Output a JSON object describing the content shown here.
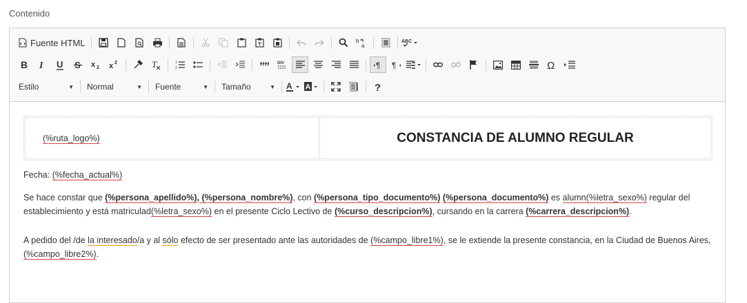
{
  "field_label": "Contenido",
  "toolbar": {
    "source_label": "Fuente HTML",
    "style_combo": "Estilo",
    "format_combo": "Normal",
    "font_combo": "Fuente",
    "size_combo": "Tamaño"
  },
  "doc": {
    "logo_placeholder": "(%ruta_logo%)",
    "title": "CONSTANCIA DE ALUMNO REGULAR",
    "fecha_label": "Fecha: ",
    "fecha_value": "(%fecha_actual%)",
    "p1": {
      "t1": "Se hace constar que ",
      "apellido": "(%persona_apellido%)",
      "comma": ",",
      "nombre": " (%persona_nombre%)",
      "t2": ", con ",
      "tipo_doc": "(%persona_tipo_documento%)",
      "sp1": " ",
      "documento": "(%persona_documento%)",
      "t3": " es ",
      "alumn": "alumn",
      "letra_sexo1": "(%letra_sexo%)",
      "t4": " regular del establecimiento y está matriculad",
      "letra_sexo2": "(%letra_sexo%)",
      "t5": " en el presente Ciclo Lectivo de ",
      "curso": "(%curso_descripcion%)",
      "t6": ", cursando en la carrera ",
      "carrera": "(%carrera_descripcion%)",
      "t7": "."
    },
    "p2": {
      "t1": "A pedido del /de ",
      "interesado": "la interesado",
      "t2": "/a y al ",
      "solo": "sólo",
      "t3": " efecto de ser presentado ante las autoridades de ",
      "campo1": "(%campo_libre1%)",
      "t4": ", se le extiende la presente constancia, en la Ciudad de Buenos Aires, ",
      "campo2": "(%campo_libre2%)",
      "t5": "."
    }
  }
}
